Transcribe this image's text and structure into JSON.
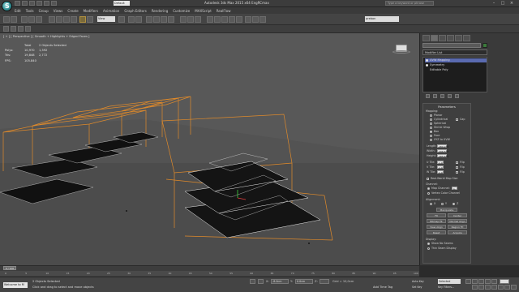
{
  "app": {
    "logo_letter": "S",
    "workspace": "Default",
    "window_title": "Autodesk 3ds Max 2015 x64     EngRCmax",
    "search_placeholder": "Type a keyword or phrase"
  },
  "menus": [
    "Edit",
    "Tools",
    "Group",
    "Views",
    "Create",
    "Modifiers",
    "Animation",
    "Graph Editors",
    "Rendering",
    "Customize",
    "MAXScript",
    "RealFlow"
  ],
  "toolbar": {
    "ref_coord": "View",
    "named_selection": "prebon"
  },
  "viewport": {
    "label": "[ + ] [ Perspective ] [ Smooth + Highlights + Edged Faces ]",
    "stats": {
      "header_total": "Total",
      "header_sel": "2 Objects Selected",
      "polys_label": "Polys:",
      "polys_total": "10,970",
      "polys_sel": "1,392",
      "tris_label": "Tris:",
      "tris_total": "19,848",
      "tris_sel": "2,772"
    },
    "fps_label": "FPS:",
    "fps_value": "105.840"
  },
  "command_panel": {
    "modifier_list": "Modifier List",
    "stack": [
      "UVW Mapping",
      "Symmetry",
      "Editable Poly"
    ],
    "stack_selected_index": 0,
    "parameters_title": "Parameters",
    "mapping_label": "Mapping:",
    "mapping_options": [
      "Planar",
      "Cylindrical",
      "Spherical",
      "Shrink Wrap",
      "Box",
      "Face",
      "XYZ to UVW"
    ],
    "mapping_selected": "Box",
    "cap_label": "Cap",
    "length_label": "Length:",
    "length_value": "280.206",
    "width_label": "Width:",
    "width_value": "296.508",
    "height_label": "Height:",
    "height_value": "285.689",
    "u_tile_label": "U Tile:",
    "u_tile_value": "1.0",
    "v_tile_label": "V Tile:",
    "v_tile_value": "1.0",
    "w_tile_label": "W Tile:",
    "w_tile_value": "1.0",
    "flip_label": "Flip",
    "real_world_label": "Real-World Map Size",
    "channel_label": "Channel:",
    "map_channel_label": "Map Channel:",
    "map_channel_value": "1",
    "vertex_color_label": "Vertex Color Channel",
    "alignment_label": "Alignment:",
    "axes": [
      "X",
      "Y",
      "Z"
    ],
    "axis_selected": "Z",
    "manipulate_label": "Manipulate",
    "fit_label": "Fit",
    "center_label": "Center",
    "bitmap_fit_label": "Bitmap Fit",
    "normal_align_label": "Normal Align",
    "view_align_label": "View Align",
    "region_fit_label": "Region Fit",
    "reset_label": "Reset",
    "acquire_label": "Acquire",
    "display_label": "Display:",
    "show_no_seams_label": "Show No Seams",
    "thin_seam_label": "Thin Seam Display"
  },
  "timeline": {
    "slider_label": "0 / 100",
    "ticks": [
      "0",
      "5",
      "10",
      "15",
      "20",
      "25",
      "30",
      "35",
      "40",
      "45",
      "50",
      "55",
      "60",
      "65",
      "70",
      "75",
      "80",
      "85",
      "90",
      "95",
      "100"
    ]
  },
  "statusbar": {
    "maxscript_text": "Welcome to M",
    "line1": "2 Objects Selected",
    "line2": "Click and drag to select and move objects",
    "x_label": "X:",
    "x_value": "-8.0cm",
    "y_label": "Y:",
    "y_value": "0.0cm",
    "z_label": "Z:",
    "z_value": "",
    "grid": "Grid = 10,0cm",
    "add_time_tag": "Add Time Tag",
    "auto_key": "Auto Key",
    "set_key": "Set Key",
    "selected_dropdown": "Selected",
    "key_filters": "Key Filters..."
  },
  "colors": {
    "viewport_bg": "#585858",
    "selection_wire": "#e8e8e8",
    "frozen_wire_orange": "#e08a2a",
    "stack_highlight": "#5a6ab0"
  }
}
